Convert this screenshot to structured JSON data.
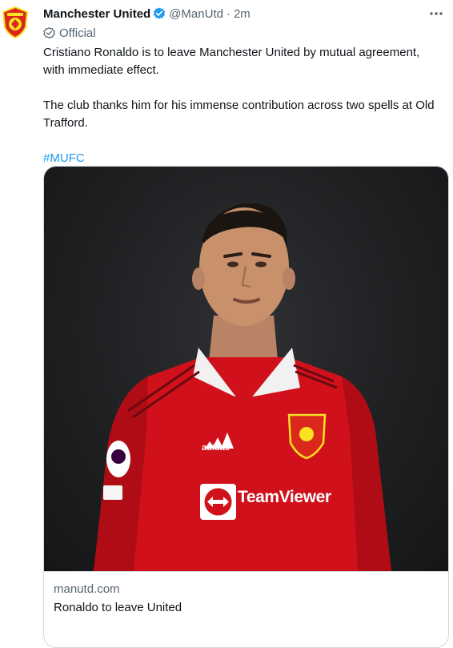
{
  "account": {
    "name": "Manchester United",
    "handle": "@ManUtd",
    "separator": "·",
    "time": "2m",
    "label": "Official"
  },
  "tweet": {
    "line1": "Cristiano Ronaldo is to leave Manchester United by mutual agreement, with immediate effect.",
    "line2": "The club thanks him for his immense contribution across two spells at Old Trafford.",
    "hashtag": "#MUFC"
  },
  "card": {
    "domain": "manutd.com",
    "title": "Ronaldo to leave United",
    "sponsor_text": "TeamViewer",
    "kit_brand": "adidas"
  },
  "icons": {
    "avatar": "manchester-united-crest-icon",
    "verified": "verified-badge-icon",
    "official": "official-label-icon",
    "more": "more-options-icon"
  },
  "colors": {
    "link": "#1d9bf0",
    "verified": "#1d9bf0",
    "secondary_text": "#536471",
    "kit_red": "#d0111b"
  }
}
